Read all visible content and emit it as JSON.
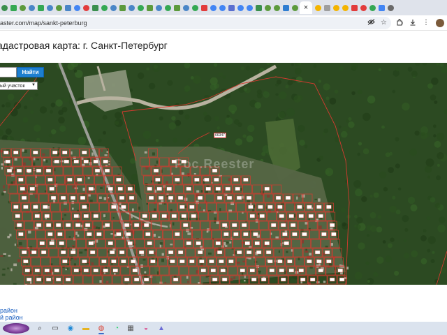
{
  "browser": {
    "url": "aster.com/map/sankt-peterburg",
    "tab_close_glyph": "×",
    "favicon_colors": [
      "#3a8f4d",
      "#34a853",
      "#5c9a3c",
      "#4a86c7",
      "#34a853",
      "#4a86c7",
      "#5c9a3c",
      "#4a86c7",
      "#4285f4",
      "#e23b3b",
      "#3a8f4d",
      "#34a853",
      "#4a86c7",
      "#5c9a3c",
      "#4a86c7",
      "#34a853",
      "#5c9a3c",
      "#4a86c7",
      "#34a853",
      "#5c9a3c",
      "#4a86c7",
      "#34a853",
      "#e23b3b",
      "#4285f4",
      "#4285f4",
      "#5a6fd0",
      "#4285f4",
      "#4285f4",
      "#3a8f4d",
      "#5c9a3c",
      "#5c9a3c",
      "#2f7dd1",
      "#5c9a3c",
      "#e23b3b",
      "#e23b3b",
      "#e23b3b",
      "#e23b3b",
      "#4a86c7",
      "#5c9a3c"
    ],
    "favicon_colors_right": [
      "#f4b400",
      "#9e9e9e",
      "#f4b400",
      "#f4b400",
      "#e23b3b",
      "#e23b3b",
      "#34a853",
      "#4285f4",
      "#6a6a6a"
    ],
    "icons": {
      "omnibox": [
        "eye-off-icon",
        "star-icon"
      ],
      "toolbar": [
        "extensions-icon",
        "download-icon",
        "profile-icon"
      ]
    }
  },
  "page": {
    "title": "адастровая карта: г. Санкт-Петербург",
    "search": {
      "value": "",
      "button_label": "Найти"
    },
    "object_type_select": "ый участок",
    "watermark": "Рос.Reester",
    "map_parcel_label": "66347",
    "district_links": [
      "район",
      "й район"
    ]
  },
  "taskbar": {
    "apps": [
      {
        "name": "search-icon",
        "glyph": "⌕",
        "color": "#333"
      },
      {
        "name": "task-view-icon",
        "glyph": "▭",
        "color": "#333"
      },
      {
        "name": "edge-icon",
        "glyph": "◉",
        "color": "#1e88d6"
      },
      {
        "name": "file-explorer-icon",
        "glyph": "▬",
        "color": "#e6b422"
      },
      {
        "name": "chrome-icon",
        "glyph": "◍",
        "color": "#db4437",
        "active": true
      },
      {
        "name": "whatsapp-icon",
        "glyph": "◔",
        "color": "#25d366"
      },
      {
        "name": "calculator-icon",
        "glyph": "▦",
        "color": "#555"
      },
      {
        "name": "paint-icon",
        "glyph": "◒",
        "color": "#d94a8c"
      },
      {
        "name": "app-icon",
        "glyph": "▲",
        "color": "#6b6bd6"
      }
    ]
  }
}
